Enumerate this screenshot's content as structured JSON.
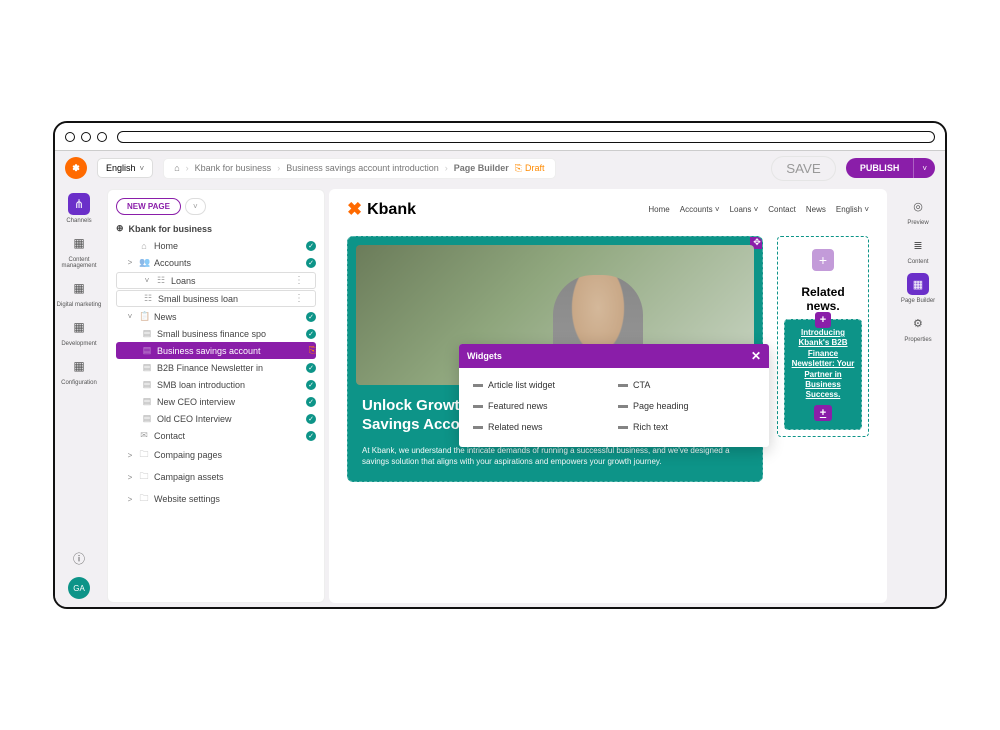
{
  "topbar": {
    "language": "English",
    "breadcrumbs": [
      "Kbank for business",
      "Business savings account introduction",
      "Page Builder"
    ],
    "status": "Draft",
    "save": "SAVE",
    "publish": "PUBLISH"
  },
  "left_rail": [
    {
      "label": "Channels",
      "active": true
    },
    {
      "label": "Content management"
    },
    {
      "label": "Digital marketing"
    },
    {
      "label": "Development"
    },
    {
      "label": "Configuration"
    }
  ],
  "avatar": "GA",
  "tree": {
    "new_page": "NEW PAGE",
    "root": "Kbank for business",
    "items": [
      {
        "label": "Home",
        "lv": 1,
        "check": true,
        "icon": "⌂"
      },
      {
        "label": "Accounts",
        "lv": 1,
        "tw": ">",
        "check": true,
        "icon": "👥"
      },
      {
        "label": "Loans",
        "lv": 1,
        "tw": "˅",
        "selbox": true,
        "icon": "☷",
        "dots": true
      },
      {
        "label": "Small business loan",
        "lv": 2,
        "selbox": true,
        "icon": "☷",
        "dots": true
      },
      {
        "label": "News",
        "lv": 1,
        "tw": "˅",
        "check": true,
        "icon": "📋"
      },
      {
        "label": "Small business finance spo",
        "lv": 2,
        "check": true,
        "icon": "▤"
      },
      {
        "label": "Business savings account",
        "lv": 2,
        "sel": true,
        "copy": true,
        "icon": "▤"
      },
      {
        "label": "B2B Finance Newsletter in",
        "lv": 2,
        "check": true,
        "icon": "▤"
      },
      {
        "label": "SMB loan introduction",
        "lv": 2,
        "check": true,
        "icon": "▤"
      },
      {
        "label": "New CEO interview",
        "lv": 2,
        "check": true,
        "icon": "▤"
      },
      {
        "label": "Old CEO Interview",
        "lv": 2,
        "check": true,
        "icon": "▤"
      },
      {
        "label": "Contact",
        "lv": 1,
        "check": true,
        "icon": "✉"
      },
      {
        "label": "Compaing pages",
        "lv": 1,
        "tw": ">",
        "icon": "🗀"
      },
      {
        "label": "Campaign assets",
        "lv": 1,
        "tw": ">",
        "icon": "🗀"
      },
      {
        "label": "Website settings",
        "lv": 1,
        "tw": ">",
        "icon": "🗀"
      }
    ]
  },
  "site": {
    "brand": "Kbank",
    "nav": [
      "Home",
      "Accounts ˅",
      "Loans ˅",
      "Contact",
      "News",
      "English ˅"
    ],
    "hero_title": "Unlock Growth Potential with Our Business Bonus Savings Account.",
    "hero_body": "At Kbank, we understand the intricate demands of running a successful business, and we've designed a savings solution that aligns with your aspirations and empowers your growth journey.",
    "related_title": "Related news.",
    "teal_text": "Introducing Kbank's B2B Finance Newsletter: Your Partner in Business Success."
  },
  "widgets": {
    "title": "Widgets",
    "items": [
      "Article list widget",
      "CTA",
      "Featured news",
      "Page heading",
      "Related news",
      "Rich text"
    ]
  },
  "right_rail": [
    {
      "label": "Preview",
      "icon": "◎"
    },
    {
      "label": "Content",
      "icon": "≣"
    },
    {
      "label": "Page Builder",
      "icon": "▦",
      "active": true
    },
    {
      "label": "Properties",
      "icon": "⚙"
    }
  ]
}
